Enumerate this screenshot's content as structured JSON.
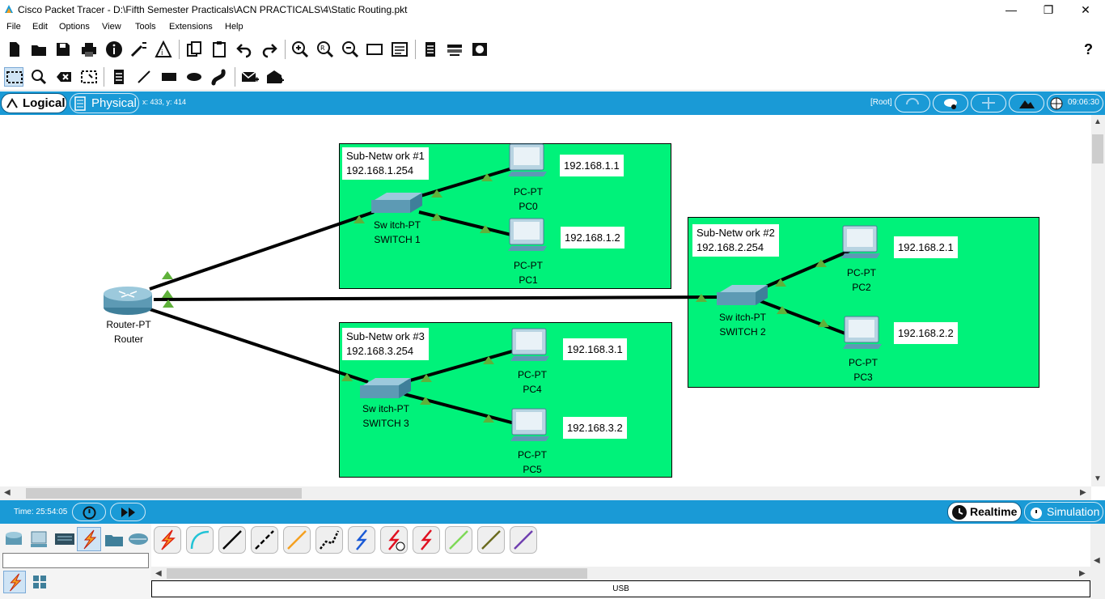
{
  "window": {
    "title": "Cisco Packet Tracer - D:\\Fifth Semester Practicals\\ACN PRACTICALS\\4\\Static Routing.pkt",
    "minimize": "—",
    "maximize": "❐",
    "close": "✕"
  },
  "menu": [
    "File",
    "Edit",
    "Options",
    "View",
    "Tools",
    "Extensions",
    "Help"
  ],
  "toolbar1": {
    "icons": [
      "new-icon",
      "open-icon",
      "save-icon",
      "print-icon",
      "info-icon",
      "wizard-icon",
      "network-info-icon",
      "copy-icon",
      "paste-icon",
      "undo-icon",
      "redo-icon",
      "zoom-in-icon",
      "zoom-reset-icon",
      "zoom-out-icon",
      "drawing-palette-icon",
      "custom-device-icon",
      "viewport-icon",
      "simulation-panel-icon",
      "cloud-icon"
    ],
    "help": "?"
  },
  "toolbar2": {
    "icons": [
      "select-icon",
      "inspect-icon",
      "delete-icon",
      "resize-icon",
      "note-icon",
      "line-icon",
      "rectangle-icon",
      "ellipse-icon",
      "freeform-icon",
      "simple-pdu-icon",
      "complex-pdu-icon"
    ]
  },
  "workspace": {
    "logical_tab": "Logical",
    "physical_tab": "Physical",
    "coords": "x: 433, y: 414",
    "root": "[Root]",
    "clock": "09:06:30"
  },
  "networks": [
    {
      "title": "Sub-Netw ork #1",
      "gateway": "192.168.1.254"
    },
    {
      "title": "Sub-Netw ork #2",
      "gateway": "192.168.2.254"
    },
    {
      "title": "Sub-Netw ork #3",
      "gateway": "192.168.3.254"
    }
  ],
  "devices": {
    "router": {
      "type": "Router-PT",
      "name": "Router"
    },
    "switch1": {
      "type": "Sw itch-PT",
      "name": "SWITCH 1"
    },
    "switch2": {
      "type": "Sw itch-PT",
      "name": "SWITCH 2"
    },
    "switch3": {
      "type": "Sw itch-PT",
      "name": "SWITCH 3"
    },
    "pc0": {
      "type": "PC-PT",
      "name": "PC0",
      "ip": "192.168.1.1"
    },
    "pc1": {
      "type": "PC-PT",
      "name": "PC1",
      "ip": "192.168.1.2"
    },
    "pc2": {
      "type": "PC-PT",
      "name": "PC2",
      "ip": "192.168.2.1"
    },
    "pc3": {
      "type": "PC-PT",
      "name": "PC3",
      "ip": "192.168.2.2"
    },
    "pc4": {
      "type": "PC-PT",
      "name": "PC4",
      "ip": "192.168.3.1"
    },
    "pc5": {
      "type": "PC-PT",
      "name": "PC5",
      "ip": "192.168.3.2"
    }
  },
  "timebar": {
    "time": "Time: 25:54:05",
    "realtime": "Realtime",
    "simulation": "Simulation"
  },
  "bottom": {
    "usb": "USB",
    "cable_colors": [
      "#f04020",
      "#22c3d6",
      "#000000",
      "#000000",
      "#f5a020",
      "#000000",
      "#1a5ad6",
      "#e01020",
      "#e01020",
      "#7ed957",
      "#6b6b20",
      "#7040b0"
    ]
  }
}
